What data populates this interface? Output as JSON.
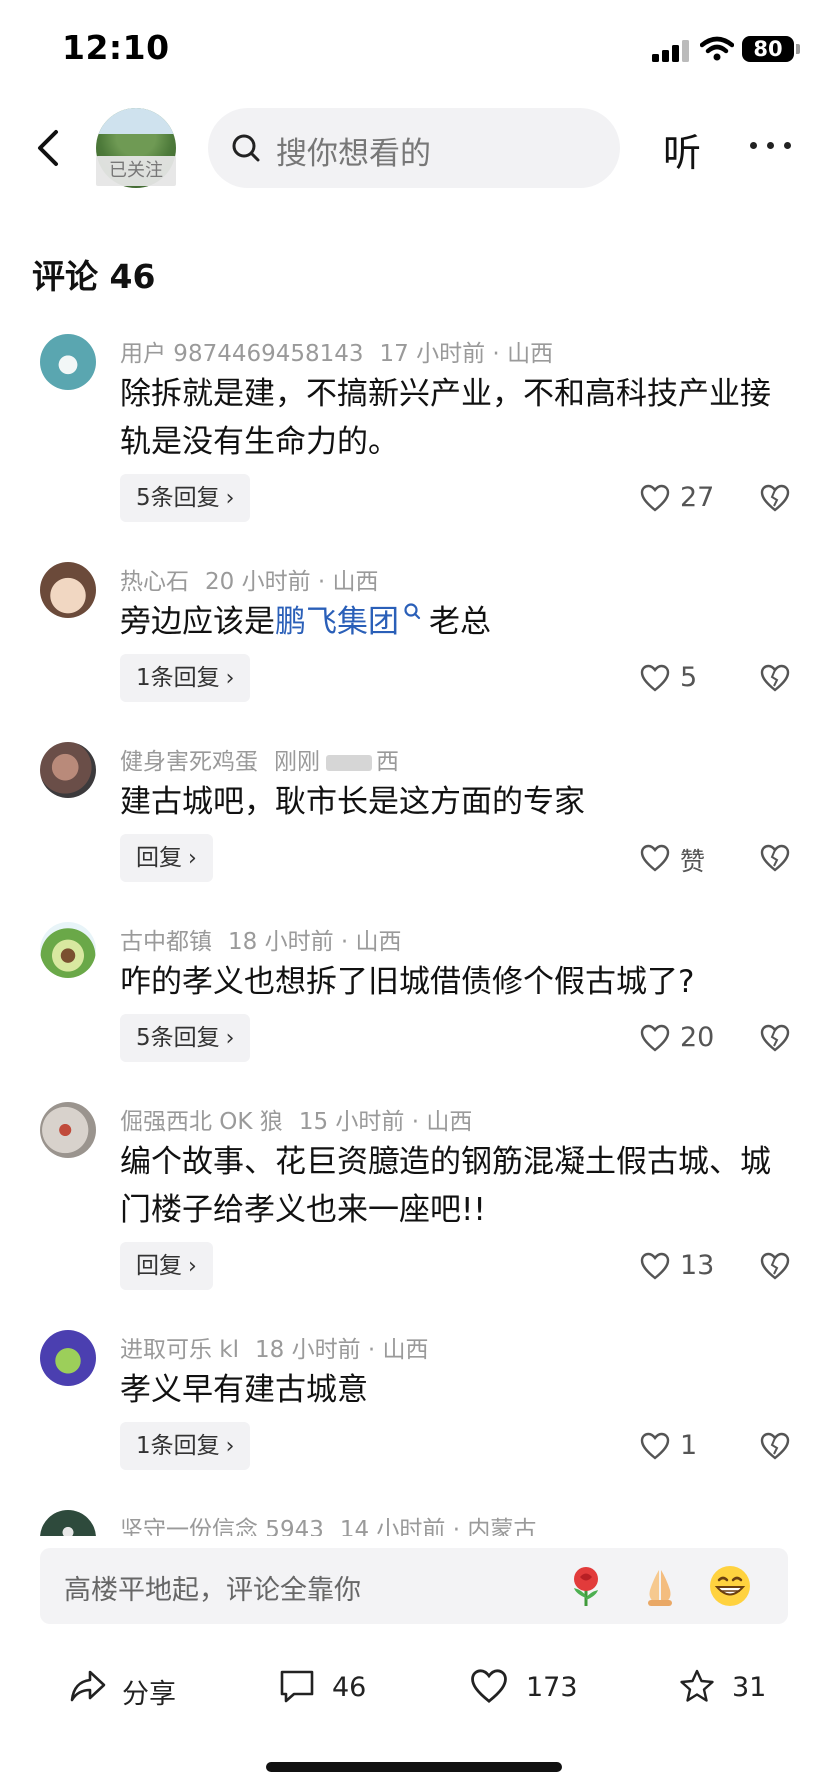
{
  "status_bar": {
    "time": "12:10",
    "battery": "80"
  },
  "nav": {
    "followed_label": "已关注",
    "search_placeholder": "搜你想看的",
    "listen_label": "听"
  },
  "comments_header": "评论 46",
  "comments": [
    {
      "user": "用户 9874469458143",
      "time": "17 小时前",
      "location": "山西",
      "text": "除拆就是建，不搞新兴产业，不和高科技产业接轨是没有生命力的。",
      "reply_label": "5条回复",
      "likes": "27"
    },
    {
      "user": "热心石",
      "time": "20 小时前",
      "location": "山西",
      "text_before": "旁边应该是",
      "link": "鹏飞集团",
      "text_after": "老总",
      "reply_label": "1条回复",
      "likes": "5"
    },
    {
      "user": "健身害死鸡蛋",
      "time": "刚刚",
      "location": "西",
      "text": "建古城吧，耿市长是这方面的专家",
      "reply_label": "回复",
      "likes": "赞"
    },
    {
      "user": "古中都镇",
      "time": "18 小时前",
      "location": "山西",
      "text": "咋的孝义也想拆了旧城借债修个假古城了?",
      "reply_label": "5条回复",
      "likes": "20"
    },
    {
      "user": "倔强西北 OK 狼",
      "time": "15 小时前",
      "location": "山西",
      "text": "编个故事、花巨资臆造的钢筋混凝土假古城、城门楼子给孝义也来一座吧!!",
      "reply_label": "回复",
      "likes": "13"
    },
    {
      "user": "进取可乐 kl",
      "time": "18 小时前",
      "location": "山西",
      "text": "孝义早有建古城意",
      "reply_label": "1条回复",
      "likes": "1"
    },
    {
      "user": "坚守一份信念 5943",
      "time": "14 小时前",
      "location": "内蒙古"
    }
  ],
  "input": {
    "placeholder": "高楼平地起，评论全靠你",
    "emojis": [
      "rose-emoji",
      "praying-hands-emoji",
      "grinning-emoji"
    ]
  },
  "bottom_bar": {
    "share_label": "分享",
    "comment_count": "46",
    "like_count": "173",
    "favorite_count": "31"
  },
  "colors": {
    "link": "#2a5fb8",
    "meta": "#9a9a9a",
    "chip_bg": "#f2f2f4"
  }
}
